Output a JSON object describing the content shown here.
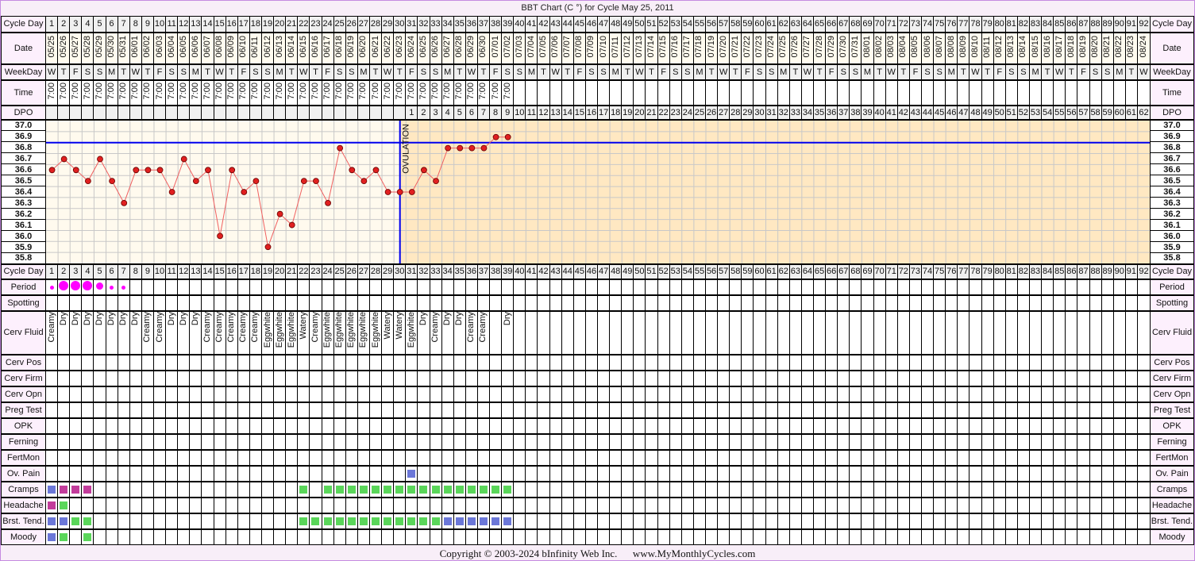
{
  "title": "BBT Chart (C °) for Cycle May 25, 2011",
  "labels": {
    "cycle_day": "Cycle Day",
    "date": "Date",
    "weekday": "WeekDay",
    "time": "Time",
    "dpo": "DPO",
    "period": "Period",
    "spotting": "Spotting",
    "cerv_fluid": "Cerv Fluid",
    "cerv_pos": "Cerv Pos",
    "cerv_firm": "Cerv Firm",
    "cerv_opn": "Cerv Opn",
    "preg_test": "Preg Test",
    "opk": "OPK",
    "ferning": "Ferning",
    "fertmon": "FertMon",
    "ov_pain": "Ov. Pain",
    "cramps": "Cramps",
    "headache": "Headache",
    "brst_tend": "Brst. Tend.",
    "moody": "Moody"
  },
  "dates": [
    "05/25",
    "05/26",
    "05/27",
    "05/28",
    "05/29",
    "05/30",
    "05/31",
    "06/01",
    "06/02",
    "06/03",
    "06/04",
    "06/05",
    "06/06",
    "06/07",
    "06/08",
    "06/09",
    "06/10",
    "06/11",
    "06/12",
    "06/13",
    "06/14",
    "06/15",
    "06/16",
    "06/17",
    "06/18",
    "06/19",
    "06/20",
    "06/21",
    "06/22",
    "06/23",
    "06/24",
    "06/25",
    "06/26",
    "06/27",
    "06/28",
    "06/29",
    "06/30",
    "07/01",
    "07/02",
    "07/03",
    "07/04",
    "07/05",
    "07/06",
    "07/07",
    "07/08",
    "07/09",
    "07/10",
    "07/11",
    "07/12",
    "07/13",
    "07/14",
    "07/15",
    "07/16",
    "07/17",
    "07/18",
    "07/19",
    "07/20",
    "07/21",
    "07/22",
    "07/23",
    "07/24",
    "07/25",
    "07/26",
    "07/27",
    "07/28",
    "07/29",
    "07/30",
    "07/31",
    "08/01",
    "08/02",
    "08/03",
    "08/04",
    "08/05",
    "08/06",
    "08/07",
    "08/08",
    "08/09",
    "08/10",
    "08/11",
    "08/12",
    "08/13",
    "08/14",
    "08/15",
    "08/16",
    "08/17",
    "08/18",
    "08/19",
    "08/20",
    "08/21",
    "08/22",
    "08/23",
    "08/24"
  ],
  "weekdays": [
    "W",
    "T",
    "F",
    "S",
    "S",
    "M",
    "T",
    "W",
    "T",
    "F",
    "S",
    "S",
    "M",
    "T",
    "W",
    "T",
    "F",
    "S",
    "S",
    "M",
    "T",
    "W",
    "T",
    "F",
    "S",
    "S",
    "M",
    "T",
    "W",
    "T",
    "F",
    "S",
    "S",
    "M",
    "T",
    "W",
    "T",
    "F",
    "S",
    "S",
    "M",
    "T",
    "W",
    "T",
    "F",
    "S",
    "S",
    "M",
    "T",
    "W",
    "T",
    "F",
    "S",
    "S",
    "M",
    "T",
    "W",
    "T",
    "F",
    "S",
    "S",
    "M",
    "T",
    "W",
    "T",
    "F",
    "S",
    "S",
    "M",
    "T",
    "W",
    "T",
    "F",
    "S",
    "S",
    "M",
    "T",
    "W",
    "T",
    "F",
    "S",
    "S",
    "M",
    "T",
    "W",
    "T",
    "F",
    "S",
    "S",
    "M",
    "T",
    "W"
  ],
  "time": "7:00",
  "time_days": 39,
  "ovulation_day": 30,
  "ovulation_label": "OVULATION",
  "cover_line": 36.85,
  "chart_data": {
    "type": "line",
    "title": "BBT Chart (C °) for Cycle May 25, 2011",
    "x_label": "Cycle Day",
    "ylim": [
      35.8,
      37.0
    ],
    "y_ticks": [
      "37.0",
      "36.9",
      "36.8",
      "36.7",
      "36.6",
      "36.5",
      "36.4",
      "36.3",
      "36.2",
      "36.1",
      "36.0",
      "35.9",
      "35.8"
    ],
    "x_range": [
      1,
      92
    ],
    "grid": true,
    "temperatures": [
      36.6,
      36.7,
      36.6,
      36.5,
      36.7,
      36.5,
      36.3,
      36.6,
      36.6,
      36.6,
      36.4,
      36.7,
      36.5,
      36.6,
      36.0,
      36.6,
      36.4,
      36.5,
      35.9,
      36.2,
      36.1,
      36.5,
      36.5,
      36.3,
      36.8,
      36.6,
      36.5,
      36.6,
      36.4,
      36.4,
      36.4,
      36.6,
      36.5,
      36.8,
      36.8,
      36.8,
      36.8,
      36.9,
      36.9
    ]
  },
  "period": [
    "light",
    "heavy",
    "heavy",
    "heavy",
    "medium",
    "light",
    "light"
  ],
  "cerv_fluid": [
    "Creamy",
    "Dry",
    "Dry",
    "Dry",
    "Dry",
    "Dry",
    "Dry",
    "Dry",
    "Creamy",
    "Creamy",
    "Dry",
    "Dry",
    "Dry",
    "Creamy",
    "Creamy",
    "Creamy",
    "Creamy",
    "Creamy",
    "Eggwhite",
    "Eggwhite",
    "Eggwhite",
    "Watery",
    "Creamy",
    "Eggwhite",
    "Eggwhite",
    "Eggwhite",
    "Eggwhite",
    "Eggwhite",
    "Watery",
    "Watery",
    "Eggwhite",
    "Dry",
    "Creamy",
    "Dry",
    "Dry",
    "Creamy",
    "Creamy",
    "",
    "Dry"
  ],
  "colors": {
    "blue": "#6b77d8",
    "magenta": "#c23c9b",
    "green": "#5ad65a",
    "temp": "#e02020",
    "line": "#0000ee",
    "pre": "#fffaee",
    "post": "#ffe8c2",
    "period": "#ff00ff"
  },
  "symptoms": {
    "ov_pain": {
      "31": "blue"
    },
    "cramps": {
      "1": "blue",
      "2": "magenta",
      "3": "magenta",
      "4": "magenta",
      "22": "green",
      "24": "green",
      "25": "green",
      "26": "green",
      "27": "green",
      "28": "green",
      "29": "green",
      "30": "green",
      "31": "green",
      "32": "green",
      "33": "green",
      "34": "green",
      "35": "green",
      "36": "green",
      "37": "green",
      "38": "green",
      "39": "green"
    },
    "headache": {
      "1": "magenta",
      "2": "green"
    },
    "brst_tend": {
      "1": "blue",
      "2": "blue",
      "3": "green",
      "4": "green",
      "22": "green",
      "23": "green",
      "24": "green",
      "25": "green",
      "26": "green",
      "27": "green",
      "28": "green",
      "29": "green",
      "30": "green",
      "31": "green",
      "32": "green",
      "33": "green",
      "34": "blue",
      "35": "blue",
      "36": "blue",
      "37": "blue",
      "38": "blue",
      "39": "blue"
    },
    "moody": {
      "1": "blue",
      "2": "green",
      "4": "green"
    }
  },
  "footer": "Copyright © 2003-2024 bInfinity Web Inc.      www.MyMonthlyCycles.com"
}
